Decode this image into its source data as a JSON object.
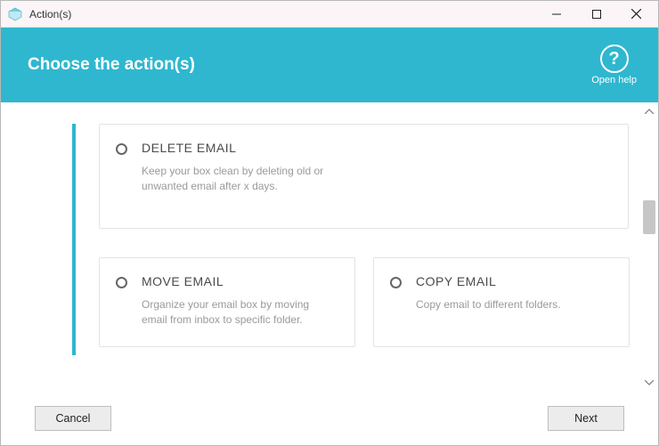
{
  "window": {
    "title": "Action(s)"
  },
  "header": {
    "title": "Choose the action(s)",
    "help_label": "Open help",
    "help_glyph": "?"
  },
  "cards": {
    "delete": {
      "title": "DELETE EMAIL",
      "desc": "Keep your box clean by deleting old or unwanted email after x days."
    },
    "move": {
      "title": "MOVE EMAIL",
      "desc": "Organize your email box by moving email from inbox to specific folder."
    },
    "copy": {
      "title": "COPY EMAIL",
      "desc": "Copy email to different folders."
    }
  },
  "footer": {
    "cancel": "Cancel",
    "next": "Next"
  }
}
